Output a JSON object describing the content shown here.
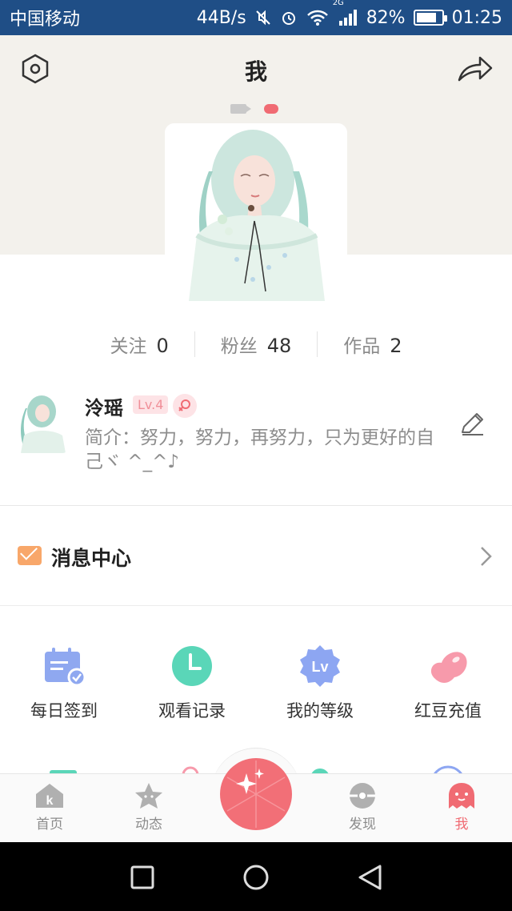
{
  "status_bar": {
    "carrier": "中国移动",
    "speed": "44B/s",
    "network_type": "2G",
    "battery_percent": "82%",
    "battery_level": 0.82,
    "time": "01:25"
  },
  "header": {
    "title": "我"
  },
  "stats": [
    {
      "label": "关注",
      "value": "0"
    },
    {
      "label": "粉丝",
      "value": "48"
    },
    {
      "label": "作品",
      "value": "2"
    }
  ],
  "profile": {
    "name": "泠瑶",
    "level": "Lv.4",
    "bio": "简介：努力，努力，再努力，只为更好的自己ヾ ^_^♪"
  },
  "message_center": {
    "label": "消息中心"
  },
  "grid": [
    {
      "label": "每日签到",
      "icon": "calendar-check-icon",
      "color": "#8fa8f0"
    },
    {
      "label": "观看记录",
      "icon": "clock-icon",
      "color": "#5ad6b8"
    },
    {
      "label": "我的等级",
      "icon": "level-badge-icon",
      "color": "#8da6f2"
    },
    {
      "label": "红豆充值",
      "icon": "red-bean-icon",
      "color": "#f79aab"
    }
  ],
  "bottom_nav": {
    "items": [
      {
        "label": "首页",
        "icon": "home-k-icon"
      },
      {
        "label": "动态",
        "icon": "star-face-icon"
      },
      {
        "label": "发现",
        "icon": "discover-ball-icon"
      },
      {
        "label": "我",
        "icon": "ghost-me-icon"
      }
    ],
    "active": "我",
    "center_icon": "sparkle-gem-icon"
  },
  "colors": {
    "accent": "#f06b73",
    "status_bar": "#1f4e86",
    "header_bg": "#f3f1ec"
  }
}
